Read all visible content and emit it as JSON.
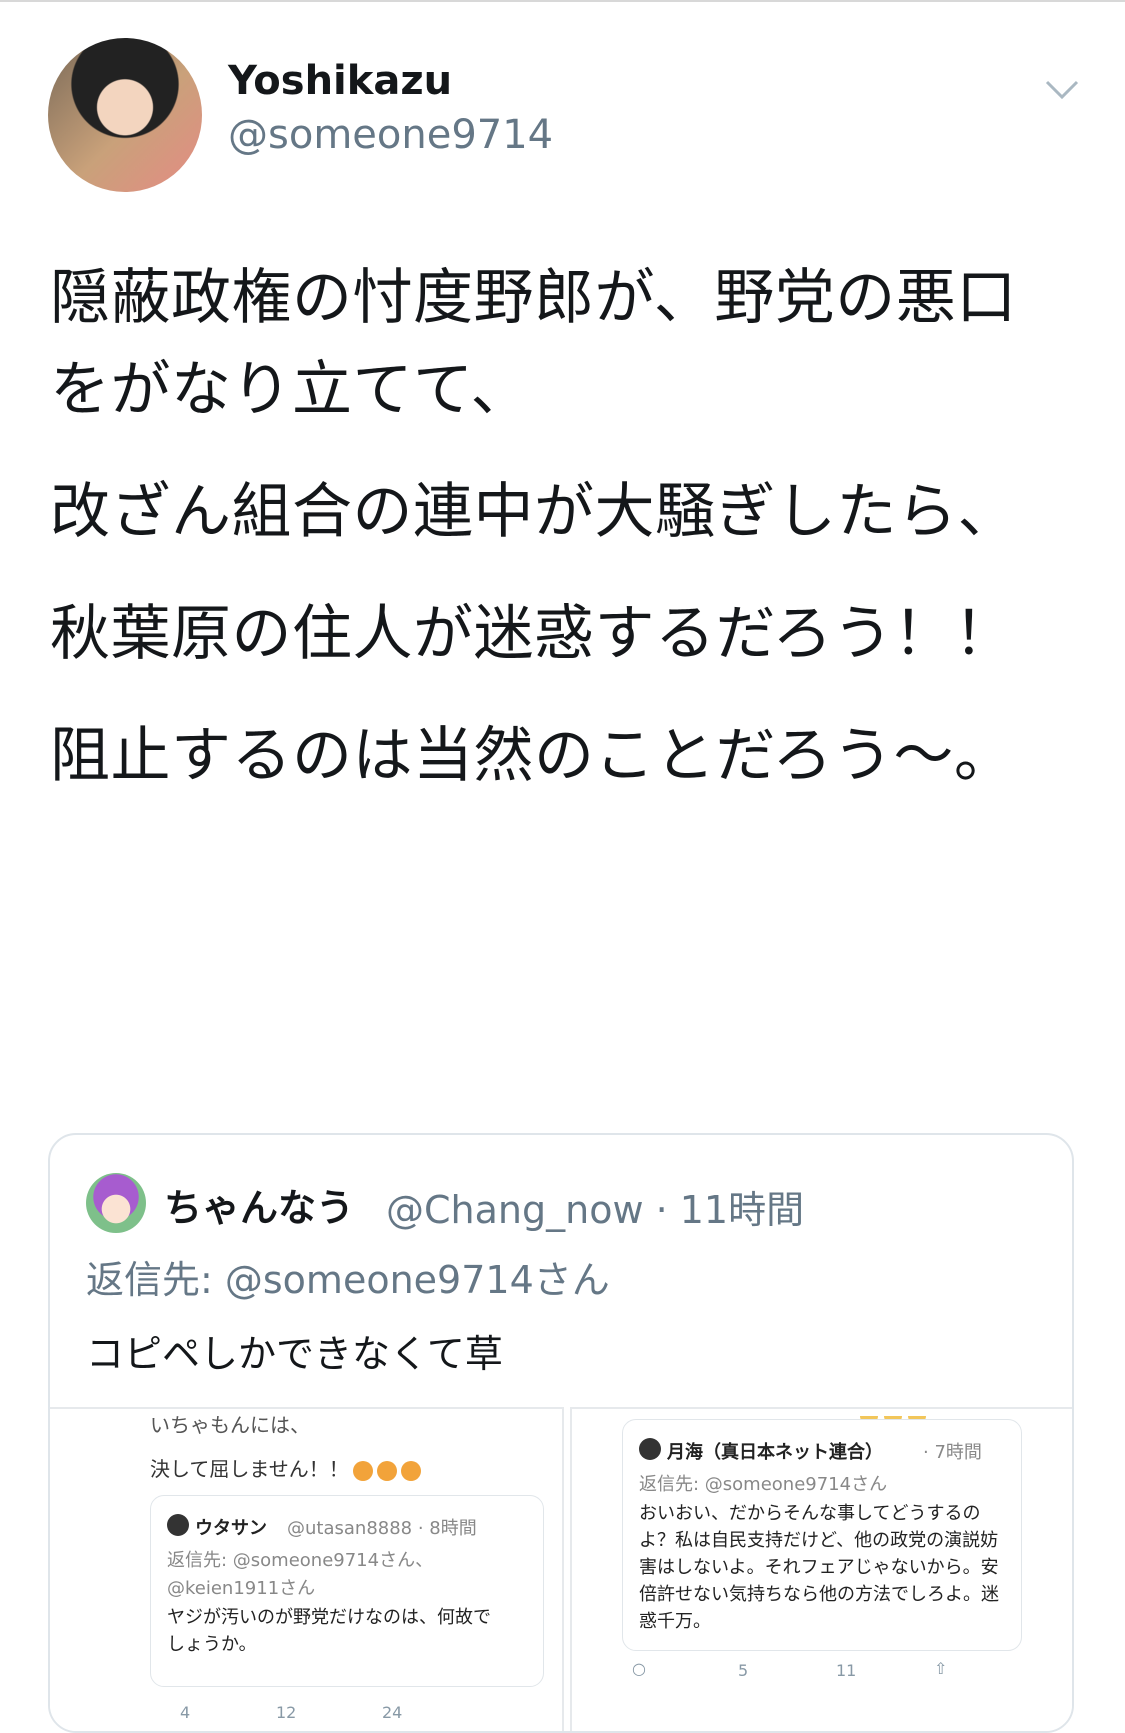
{
  "tweet": {
    "author_name": "Yoshikazu",
    "author_handle": "@someone9714",
    "lines": [
      "隠蔽政権の忖度野郎が、野党の悪口をがなり立てて、",
      "改ざん組合の連中が大騒ぎしたら、",
      "秋葉原の住人が迷惑するだろう！！",
      "阻止するのは当然のことだろう〜。"
    ]
  },
  "quote": {
    "name": "ちゃんなう",
    "handle_time": "@Chang_now · 11時間",
    "reply_to": "返信先: @someone9714さん",
    "text": "コピペしかできなくて草",
    "left_shot": {
      "cut_text": "いちゃもんには、",
      "line": "決して屈しません！！",
      "card": {
        "name": "ウタサン",
        "meta": "@utasan8888 · 8時間",
        "reply": "返信先: @someone9714さん、",
        "reply2": "@keien1911さん",
        "body": "ヤジが汚いのが野党だけなのは、何故でしょうか。"
      },
      "counts": {
        "reply": "4",
        "retweet": "12",
        "like": "24"
      }
    },
    "right_shot": {
      "card": {
        "name": "月海（真日本ネット連合）",
        "meta": "· 7時間",
        "reply": "返信先: @someone9714さん",
        "body": "おいおい、だからそんな事してどうするのよ？私は自民支持だけど、他の政党の演説妨害はしないよ。それフェアじゃないから。安倍許せない気持ちなら他の方法でしろよ。迷惑千万。"
      },
      "counts": {
        "retweet": "5",
        "like": "11"
      }
    }
  }
}
